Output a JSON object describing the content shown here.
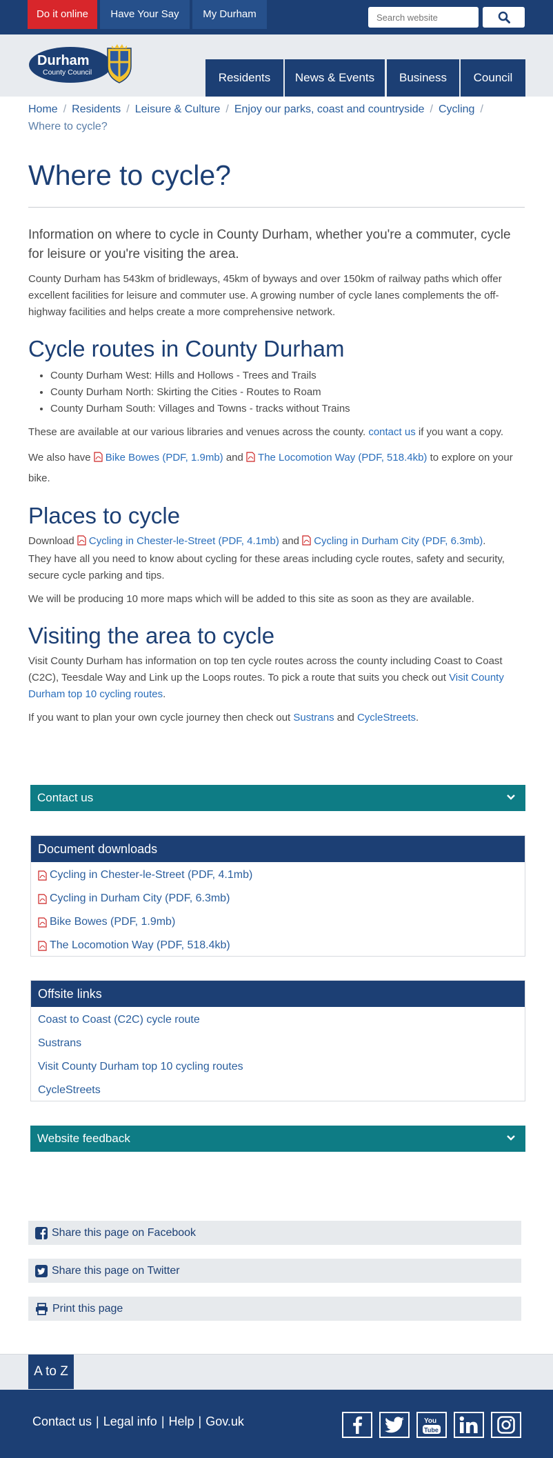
{
  "topbar": {
    "do_it_online": "Do it online",
    "have_your_say": "Have Your Say",
    "my_durham": "My Durham",
    "search_placeholder": "Search website"
  },
  "logo": {
    "line1": "Durham",
    "line2": "County Council"
  },
  "nav": [
    "Residents",
    "News & Events",
    "Business",
    "Council"
  ],
  "breadcrumb": [
    "Home",
    "Residents",
    "Leisure & Culture",
    "Enjoy our parks, coast and countryside",
    "Cycling",
    "Where to cycle?"
  ],
  "page": {
    "title": "Where to cycle?",
    "lead": "Information on where to cycle in County Durham, whether you're a commuter, cycle for leisure or you're visiting the area.",
    "intro": "County Durham has 543km of bridleways, 45km of byways and over 150km of railway paths which offer excellent facilities for leisure and commuter use. A growing number of cycle lanes complements the off-highway facilities and helps create a more comprehensive network."
  },
  "routes": {
    "heading": "Cycle routes in County Durham",
    "items": [
      "County Durham West: Hills and Hollows - Trees and Trails",
      "County Durham North: Skirting the Cities - Routes to Roam",
      "County Durham South: Villages and Towns - tracks without Trains"
    ],
    "available_text": "These are available at our various libraries and venues across the county.",
    "contact_link": "contact us",
    "available_suffix": "if you want a copy.",
    "also_prefix": "We also have",
    "bike_bowes": "Bike Bowes (PDF, 1.9mb)",
    "and": "and",
    "locomotion": "The Locomotion Way (PDF, 518.4kb)",
    "also_suffix": "to explore on your bike."
  },
  "places": {
    "heading": "Places to cycle",
    "download": "Download",
    "chester": "Cycling in Chester-le-Street (PDF, 4.1mb)",
    "and": "and",
    "durham_city": "Cycling in Durham City (PDF, 6.3mb)",
    "period": ".",
    "info": "They have all you need to know about cycling for these areas including cycle routes, safety and security, secure cycle parking and tips.",
    "more_maps": "We will be producing 10 more maps which will be added to this site as soon as they are available."
  },
  "visiting": {
    "heading": "Visiting the area to cycle",
    "text": "Visit County Durham has information on top ten cycle routes across the county including Coast to Coast (C2C), Teesdale Way and Link up the Loops routes. To pick a route that suits you check out",
    "top10_link": "Visit County Durham top 10 cycling routes",
    "period": ".",
    "plan_prefix": "If you want to plan your own cycle journey then check out",
    "sustrans": "Sustrans",
    "and": "and",
    "cyclestreets": "CycleStreets",
    "plan_suffix": "."
  },
  "contact_bar": "Contact us",
  "downloads": {
    "heading": "Document downloads",
    "items": [
      "Cycling in Chester-le-Street (PDF, 4.1mb)",
      "Cycling in Durham City (PDF, 6.3mb)",
      "Bike Bowes (PDF, 1.9mb)",
      "The Locomotion Way (PDF, 518.4kb)"
    ]
  },
  "offsite": {
    "heading": "Offsite links",
    "items": [
      "Coast to Coast (C2C) cycle route",
      "Sustrans",
      "Visit County Durham top 10 cycling routes",
      "CycleStreets"
    ]
  },
  "feedback_bar": "Website feedback",
  "share": {
    "facebook": "Share this page on Facebook",
    "twitter": "Share this page on Twitter",
    "print": "Print this page"
  },
  "atoz": "A to Z",
  "footer": {
    "links": [
      "Contact us",
      "Legal info",
      "Help",
      "Gov.uk"
    ],
    "social_icons": [
      "facebook-icon",
      "twitter-icon",
      "youtube-icon",
      "linkedin-icon",
      "instagram-icon"
    ]
  },
  "colors": {
    "primary": "#1c3f74",
    "accent_red": "#d8262b",
    "teal": "#0e7c85",
    "link": "#2a6ebb"
  }
}
